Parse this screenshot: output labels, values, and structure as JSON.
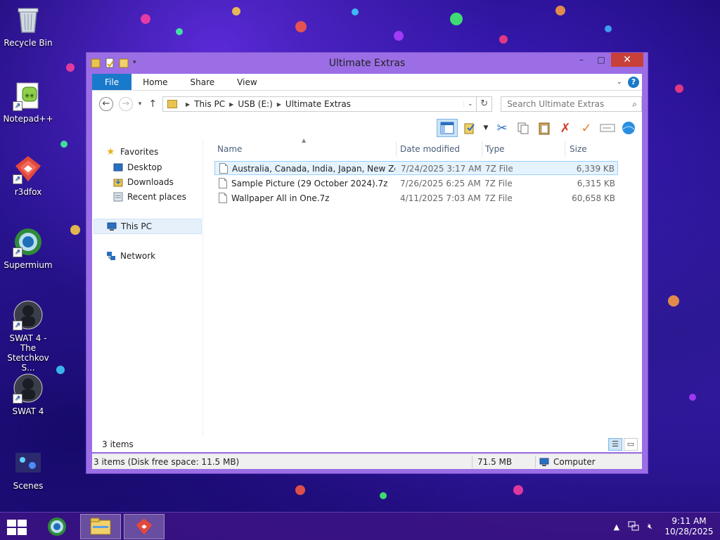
{
  "desktop": {
    "icons": [
      {
        "label": "Recycle Bin",
        "icon": "recycle-bin-icon"
      },
      {
        "label": "Notepad++",
        "icon": "notepadpp-icon"
      },
      {
        "label": "r3dfox",
        "icon": "r3dfox-icon"
      },
      {
        "label": "Supermium",
        "icon": "supermium-icon"
      },
      {
        "label": "SWAT 4 - The Stetchkov S...",
        "icon": "swat4-expansion-icon"
      },
      {
        "label": "SWAT 4",
        "icon": "swat4-icon"
      },
      {
        "label": "Scenes",
        "icon": "scenes-icon"
      }
    ]
  },
  "window": {
    "title": "Ultimate Extras",
    "minimize": "–",
    "maximize": "□",
    "close": "✕",
    "ribbon_tabs": [
      "File",
      "Home",
      "Share",
      "View"
    ],
    "help": "?",
    "address": {
      "crumbs": [
        "This PC",
        "USB (E:)",
        "Ultimate Extras"
      ]
    },
    "search": {
      "placeholder": "Search Ultimate Extras"
    },
    "nav": {
      "favorites": "Favorites",
      "desktop": "Desktop",
      "downloads": "Downloads",
      "recent": "Recent places",
      "this_pc": "This PC",
      "network": "Network"
    },
    "columns": {
      "name": "Name",
      "date": "Date modified",
      "type": "Type",
      "size": "Size"
    },
    "files": [
      {
        "name": "Australia, Canada, India, Japan, New Zeal...",
        "date": "7/24/2025 3:17 AM",
        "type": "7Z File",
        "size": "6,339 KB"
      },
      {
        "name": "Sample Picture (29 October 2024).7z",
        "date": "7/26/2025 6:25 AM",
        "type": "7Z File",
        "size": "6,315 KB"
      },
      {
        "name": "Wallpaper All in One.7z",
        "date": "4/11/2025 7:03 AM",
        "type": "7Z File",
        "size": "60,658 KB"
      }
    ],
    "item_count": "3 items",
    "status": {
      "disk_info": "3 items (Disk free space: 11.5 MB)",
      "size": "71.5 MB",
      "location": "Computer"
    }
  },
  "taskbar": {
    "time": "9:11 AM",
    "date": "10/28/2025"
  }
}
